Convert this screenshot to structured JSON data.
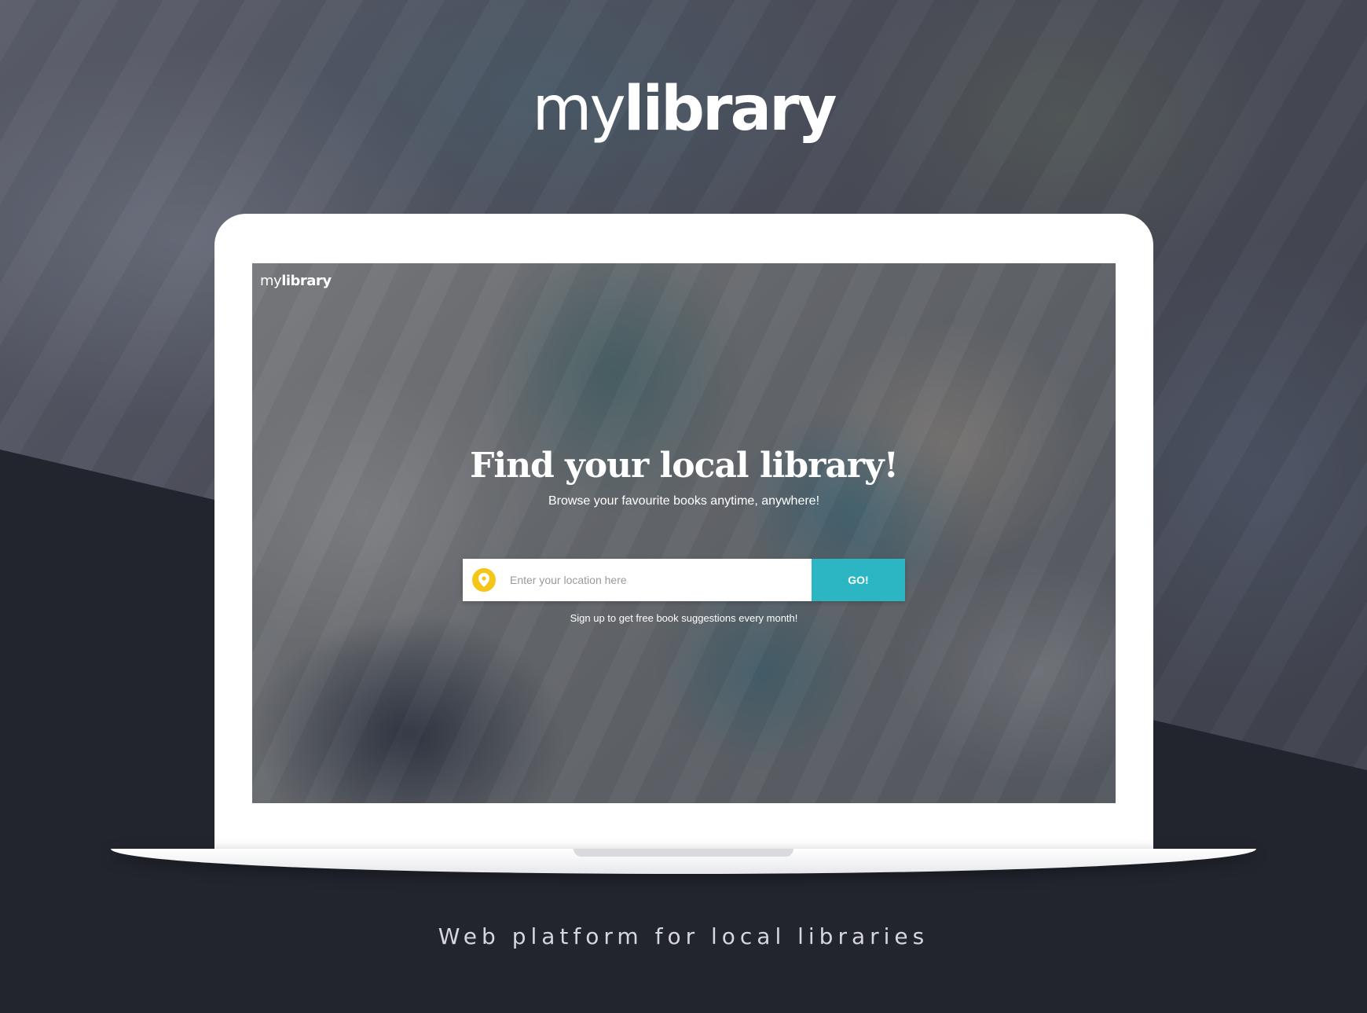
{
  "brand": {
    "prefix": "my",
    "name": "library"
  },
  "screen": {
    "logo": {
      "prefix": "my",
      "name": "library"
    },
    "hero": {
      "title": "Find your local library!",
      "subtitle": "Browse your favourite books anytime, anywhere!"
    },
    "search": {
      "icon": "map-pin-icon",
      "placeholder": "Enter your location here",
      "value": "",
      "button_label": "GO!"
    },
    "signup_text": "Sign up to get free book suggestions every month!"
  },
  "tagline": "Web platform for local libraries",
  "colors": {
    "accent": "#2cb6c4",
    "pin": "#f5c518",
    "dark_background": "#22252e"
  }
}
